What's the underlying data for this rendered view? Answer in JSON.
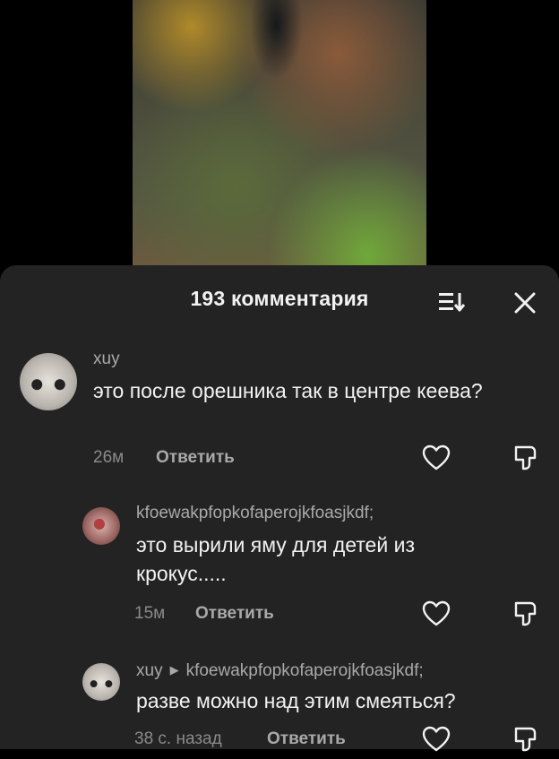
{
  "video": {
    "thumbnail_icon": "video-thumbnail"
  },
  "sheet": {
    "title": "193 комментария",
    "sort_icon": "sort-icon",
    "close_icon": "close-icon"
  },
  "comments": [
    {
      "username": "xuy",
      "text": "это после орешника так в центре кеева?",
      "time": "26м",
      "reply_label": "Ответить"
    },
    {
      "username": "kfoewakpfopkofaperojkfoasjkdf;",
      "text": "это вырили яму для детей из крокус.....",
      "time": "15м",
      "reply_label": "Ответить"
    },
    {
      "username": "xuy",
      "reply_to": "kfoewakpfopkofaperojkfoasjkdf;",
      "text": "разве можно над этим смеяться?",
      "time": "38 с. назад",
      "reply_label": "Ответить"
    }
  ],
  "colors": {
    "sheet_bg": "#232323",
    "text_primary": "#f2f2f2",
    "text_secondary": "#a9a9a9"
  }
}
